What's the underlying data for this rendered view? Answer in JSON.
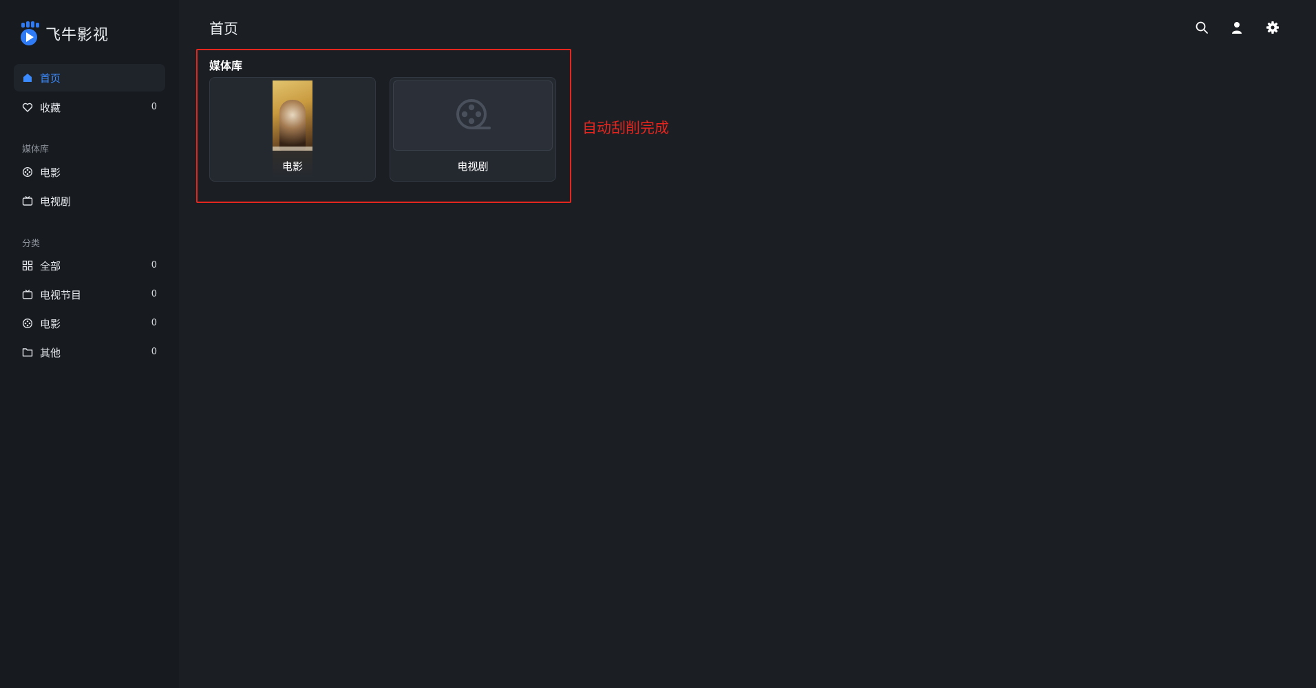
{
  "app": {
    "name": "飞牛影视",
    "accent_color": "#3b8bff",
    "annotation_color": "#e5261f"
  },
  "sidebar": {
    "nav": [
      {
        "label": "首页",
        "icon": "home-icon",
        "active": true
      },
      {
        "label": "收藏",
        "icon": "heart-icon",
        "count": "0"
      }
    ],
    "library_section_label": "媒体库",
    "libraries": [
      {
        "label": "电影",
        "icon": "film-reel-icon"
      },
      {
        "label": "电视剧",
        "icon": "tv-icon"
      }
    ],
    "category_section_label": "分类",
    "categories": [
      {
        "label": "全部",
        "icon": "grid-icon",
        "count": "0"
      },
      {
        "label": "电视节目",
        "icon": "tv-icon",
        "count": "0"
      },
      {
        "label": "电影",
        "icon": "film-reel-icon",
        "count": "0"
      },
      {
        "label": "其他",
        "icon": "folder-icon",
        "count": "0"
      }
    ]
  },
  "header": {
    "title": "首页",
    "icons": [
      "search-icon",
      "user-icon",
      "gear-icon"
    ]
  },
  "main": {
    "library_title": "媒体库",
    "cards": [
      {
        "label": "电影",
        "thumb": "movie-poster"
      },
      {
        "label": "电视剧",
        "thumb": "film-reel-placeholder-icon"
      }
    ]
  },
  "annotation": {
    "text": "自动刮削完成"
  }
}
